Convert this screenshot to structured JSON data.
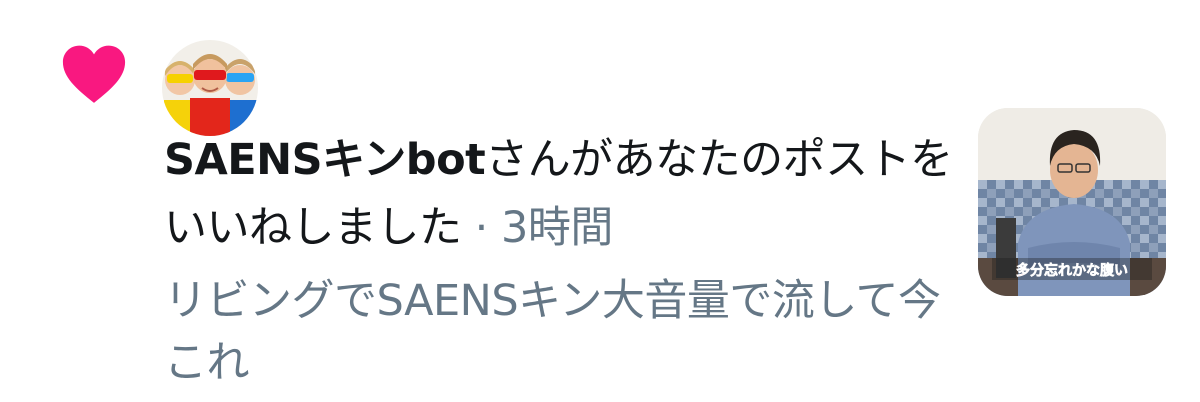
{
  "notification": {
    "user_name": "SAENSキンbot",
    "action_text": "さんがあなたのポストをいいねしました",
    "separator": "·",
    "time_ago": "3時間",
    "tweet_text": "リビングでSAENSキン大音量で流して今これ",
    "thumbnail_caption": "多分忘れかな腹い"
  },
  "colors": {
    "heart": "#f91880",
    "primary_text": "#14171a",
    "secondary_text": "#657786"
  },
  "icons": {
    "like": "heart-icon"
  }
}
